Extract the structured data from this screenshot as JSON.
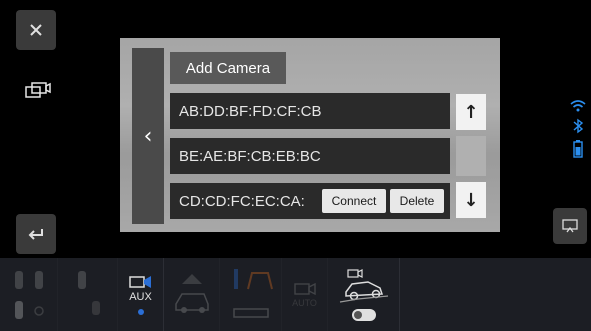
{
  "left_rail": {
    "close_icon": "close-icon",
    "camera_toggle_icon": "camera-switch-icon",
    "back_icon": "return-icon"
  },
  "status": {
    "icons": [
      "wifi-icon",
      "bluetooth-icon",
      "battery-icon"
    ],
    "accent_color": "#2b8ff0"
  },
  "dialog": {
    "add_camera_label": "Add Camera",
    "rows": [
      {
        "mac": "AB:DD:BF:FD:CF:CB"
      },
      {
        "mac": "BE:AE:BF:CB:EB:BC"
      },
      {
        "mac": "CD:CD:FC:EC:CA:",
        "connect_label": "Connect",
        "delete_label": "Delete"
      }
    ],
    "nav_back_glyph": "‹",
    "scroll_up_glyph": "↑",
    "scroll_down_glyph": "↓"
  },
  "bottom_bar": {
    "aux_label": "AUX",
    "auto_label": "AUTO",
    "selected_color": "#2b6fd6"
  }
}
